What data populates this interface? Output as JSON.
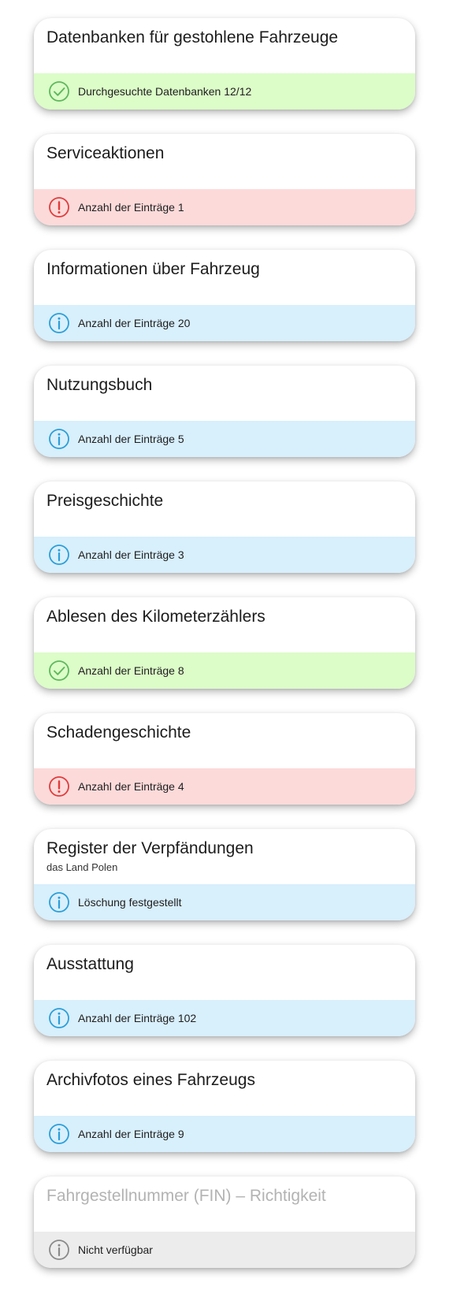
{
  "colors": {
    "success_bg": "#dcfcc8",
    "success_icon": "#5cb85c",
    "danger_bg": "#fddada",
    "danger_icon": "#e23b3b",
    "info_bg": "#d8effc",
    "info_icon": "#2a9fd8",
    "neutral_bg": "#ececec",
    "neutral_icon": "#8a8a8a"
  },
  "cards": [
    {
      "title": "Datenbanken für gestohlene Fahrzeuge",
      "subtitle": "",
      "status": "success",
      "icon": "check-circle-icon",
      "status_text": "Durchgesuchte Datenbanken 12/12"
    },
    {
      "title": "Serviceaktionen",
      "subtitle": "",
      "status": "danger",
      "icon": "exclamation-circle-icon",
      "status_text": "Anzahl der Einträge 1"
    },
    {
      "title": "Informationen über Fahrzeug",
      "subtitle": "",
      "status": "info",
      "icon": "info-circle-icon",
      "status_text": "Anzahl der Einträge 20"
    },
    {
      "title": "Nutzungsbuch",
      "subtitle": "",
      "status": "info",
      "icon": "info-circle-icon",
      "status_text": "Anzahl der Einträge 5"
    },
    {
      "title": "Preisgeschichte",
      "subtitle": "",
      "status": "info",
      "icon": "info-circle-icon",
      "status_text": "Anzahl der Einträge 3"
    },
    {
      "title": "Ablesen des Kilometerzählers",
      "subtitle": "",
      "status": "success",
      "icon": "check-circle-icon",
      "status_text": "Anzahl der Einträge 8"
    },
    {
      "title": "Schadengeschichte",
      "subtitle": "",
      "status": "danger",
      "icon": "exclamation-circle-icon",
      "status_text": "Anzahl der Einträge 4"
    },
    {
      "title": "Register der Verpfändungen",
      "subtitle": "das Land Polen",
      "status": "info",
      "icon": "info-circle-icon",
      "status_text": "Löschung festgestellt"
    },
    {
      "title": "Ausstattung",
      "subtitle": "",
      "status": "info",
      "icon": "info-circle-icon",
      "status_text": "Anzahl der Einträge 102"
    },
    {
      "title": "Archivfotos eines Fahrzeugs",
      "subtitle": "",
      "status": "info",
      "icon": "info-circle-icon",
      "status_text": "Anzahl der Einträge 9"
    },
    {
      "title": "Fahrgestellnummer (FIN) – Richtigkeit",
      "subtitle": "",
      "status": "neutral",
      "icon": "info-circle-icon",
      "status_text": "Nicht verfügbar"
    }
  ]
}
